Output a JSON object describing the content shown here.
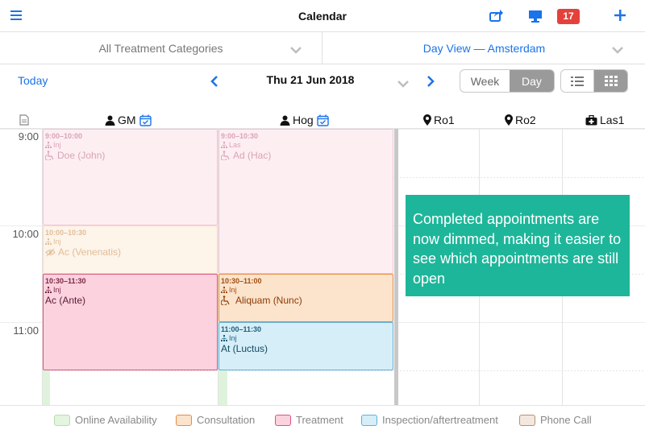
{
  "header": {
    "title": "Calendar",
    "notification_count": "17"
  },
  "filters": {
    "category": "All Treatment Categories",
    "view": "Day View — Amsterdam"
  },
  "nav": {
    "today": "Today",
    "date": "Thu 21 Jun 2018",
    "week": "Week",
    "day": "Day"
  },
  "columns": [
    {
      "label": "GM",
      "icon": "person-icon"
    },
    {
      "label": "Hog",
      "icon": "person-icon"
    },
    {
      "label": "Ro1",
      "icon": "map-pin-icon"
    },
    {
      "label": "Ro2",
      "icon": "map-pin-icon"
    },
    {
      "label": "Las1",
      "icon": "medical-case-icon"
    }
  ],
  "times": [
    "9:00",
    "10:00",
    "11:00"
  ],
  "appointments": [
    {
      "time": "9:00–10:00",
      "sub": "Inj",
      "name": "Doe (John)",
      "type": "treatment",
      "dimmed": true
    },
    {
      "time": "10:00–10:30",
      "sub": "Inj",
      "name": "Ac (Venenatis)",
      "type": "consultation",
      "dimmed": true
    },
    {
      "time": "10:30–11:30",
      "sub": "Inj",
      "name": "Ac (Ante)",
      "type": "treatment",
      "dimmed": false
    },
    {
      "time": "9:00–10:30",
      "sub": "Las",
      "name": "Ad (Hac)",
      "type": "treatment",
      "dimmed": true
    },
    {
      "time": "10:30–11:00",
      "sub": "Inj",
      "name": "Aliquam (Nunc)",
      "type": "consultation",
      "dimmed": false
    },
    {
      "time": "11:00–11:30",
      "sub": "Inj",
      "name": "At (Luctus)",
      "type": "inspection",
      "dimmed": false
    }
  ],
  "tooltip": "Completed appointments are now dimmed, making it easier to see which appointments are still open",
  "legend": [
    {
      "label": "Online Availability",
      "color": "#e3f4df",
      "border": "#b8dcb1"
    },
    {
      "label": "Consultation",
      "color": "#fce3cc",
      "border": "#e68c42"
    },
    {
      "label": "Treatment",
      "color": "#fbd2de",
      "border": "#d9567e"
    },
    {
      "label": "Inspection/aftertreatment",
      "color": "#d6eef8",
      "border": "#5db2d8"
    },
    {
      "label": "Phone Call",
      "color": "#f4e7de",
      "border": "#b3917a"
    }
  ]
}
